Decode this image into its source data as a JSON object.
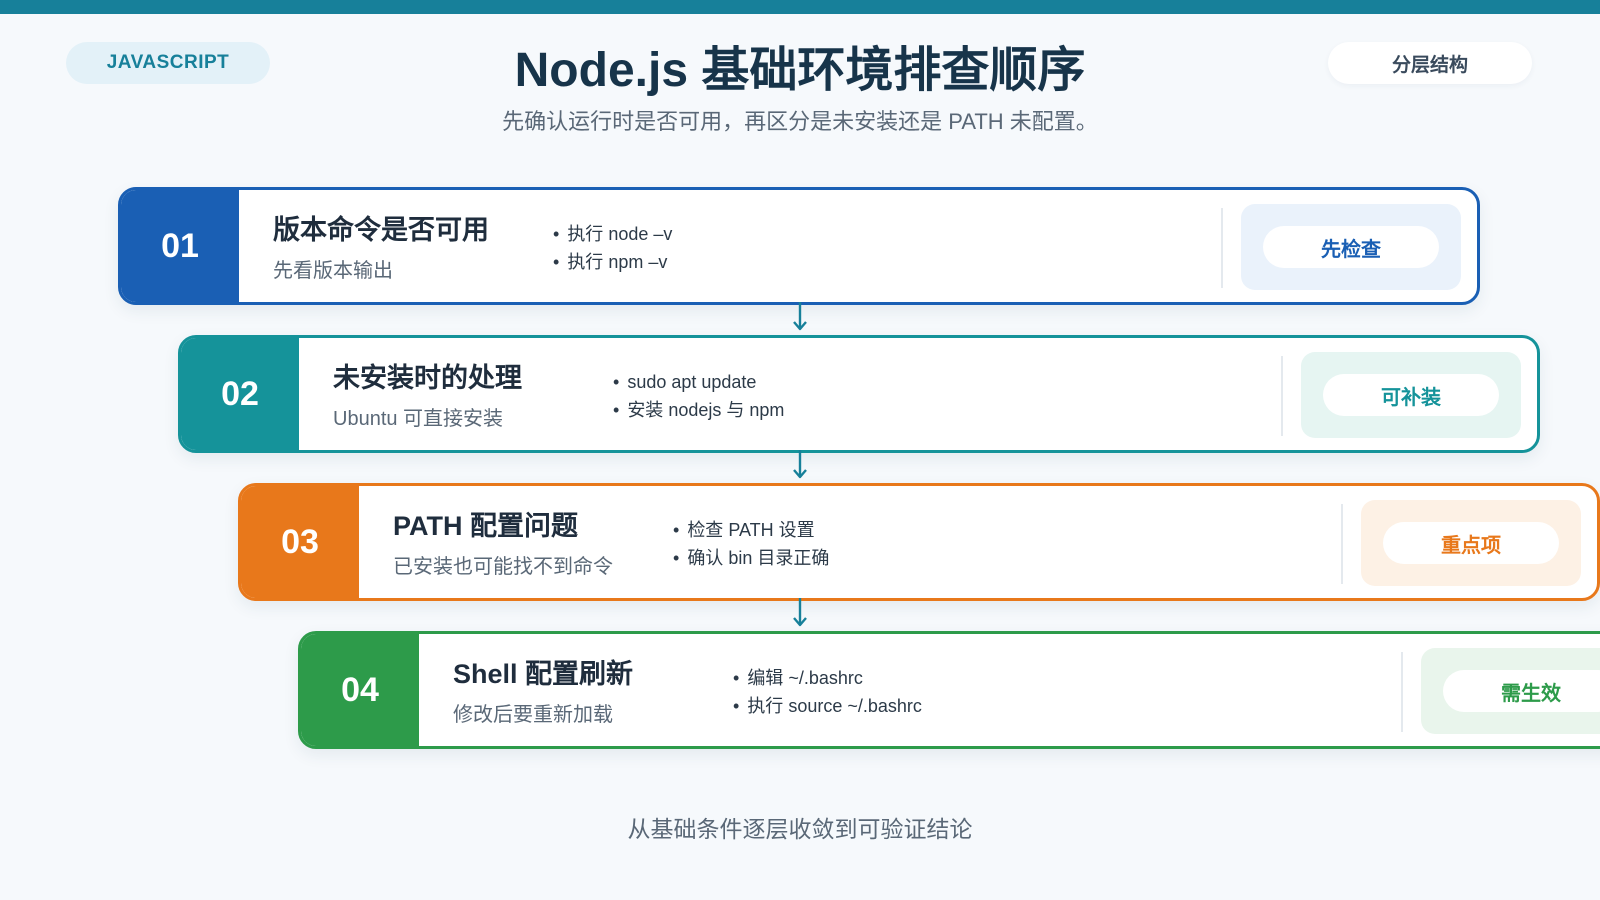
{
  "header": {
    "tag": "JAVASCRIPT",
    "title": "Node.js 基础环境排查顺序",
    "subtitle": "先确认运行时是否可用，再区分是未安装还是 PATH 未配置。",
    "layer_label": "分层结构"
  },
  "steps": [
    {
      "number": "01",
      "title": "版本命令是否可用",
      "desc": "先看版本输出",
      "bullets": [
        "执行 node –v",
        "执行 npm –v"
      ],
      "badge": "先检查",
      "color": "#1a5fb4"
    },
    {
      "number": "02",
      "title": "未安装时的处理",
      "desc": "Ubuntu 可直接安装",
      "bullets": [
        "sudo apt update",
        "安装 nodejs 与 npm"
      ],
      "badge": "可补装",
      "color": "#15939a"
    },
    {
      "number": "03",
      "title": "PATH 配置问题",
      "desc": "已安装也可能找不到命令",
      "bullets": [
        "检查 PATH 设置",
        "确认 bin 目录正确"
      ],
      "badge": "重点项",
      "color": "#e8781b"
    },
    {
      "number": "04",
      "title": "Shell 配置刷新",
      "desc": "修改后要重新加载",
      "bullets": [
        "编辑 ~/.bashrc",
        "执行 source ~/.bashrc"
      ],
      "badge": "需生效",
      "color": "#2d9b4a"
    }
  ],
  "connector_color": "#17809a",
  "footer": "从基础条件逐层收敛到可验证结论"
}
